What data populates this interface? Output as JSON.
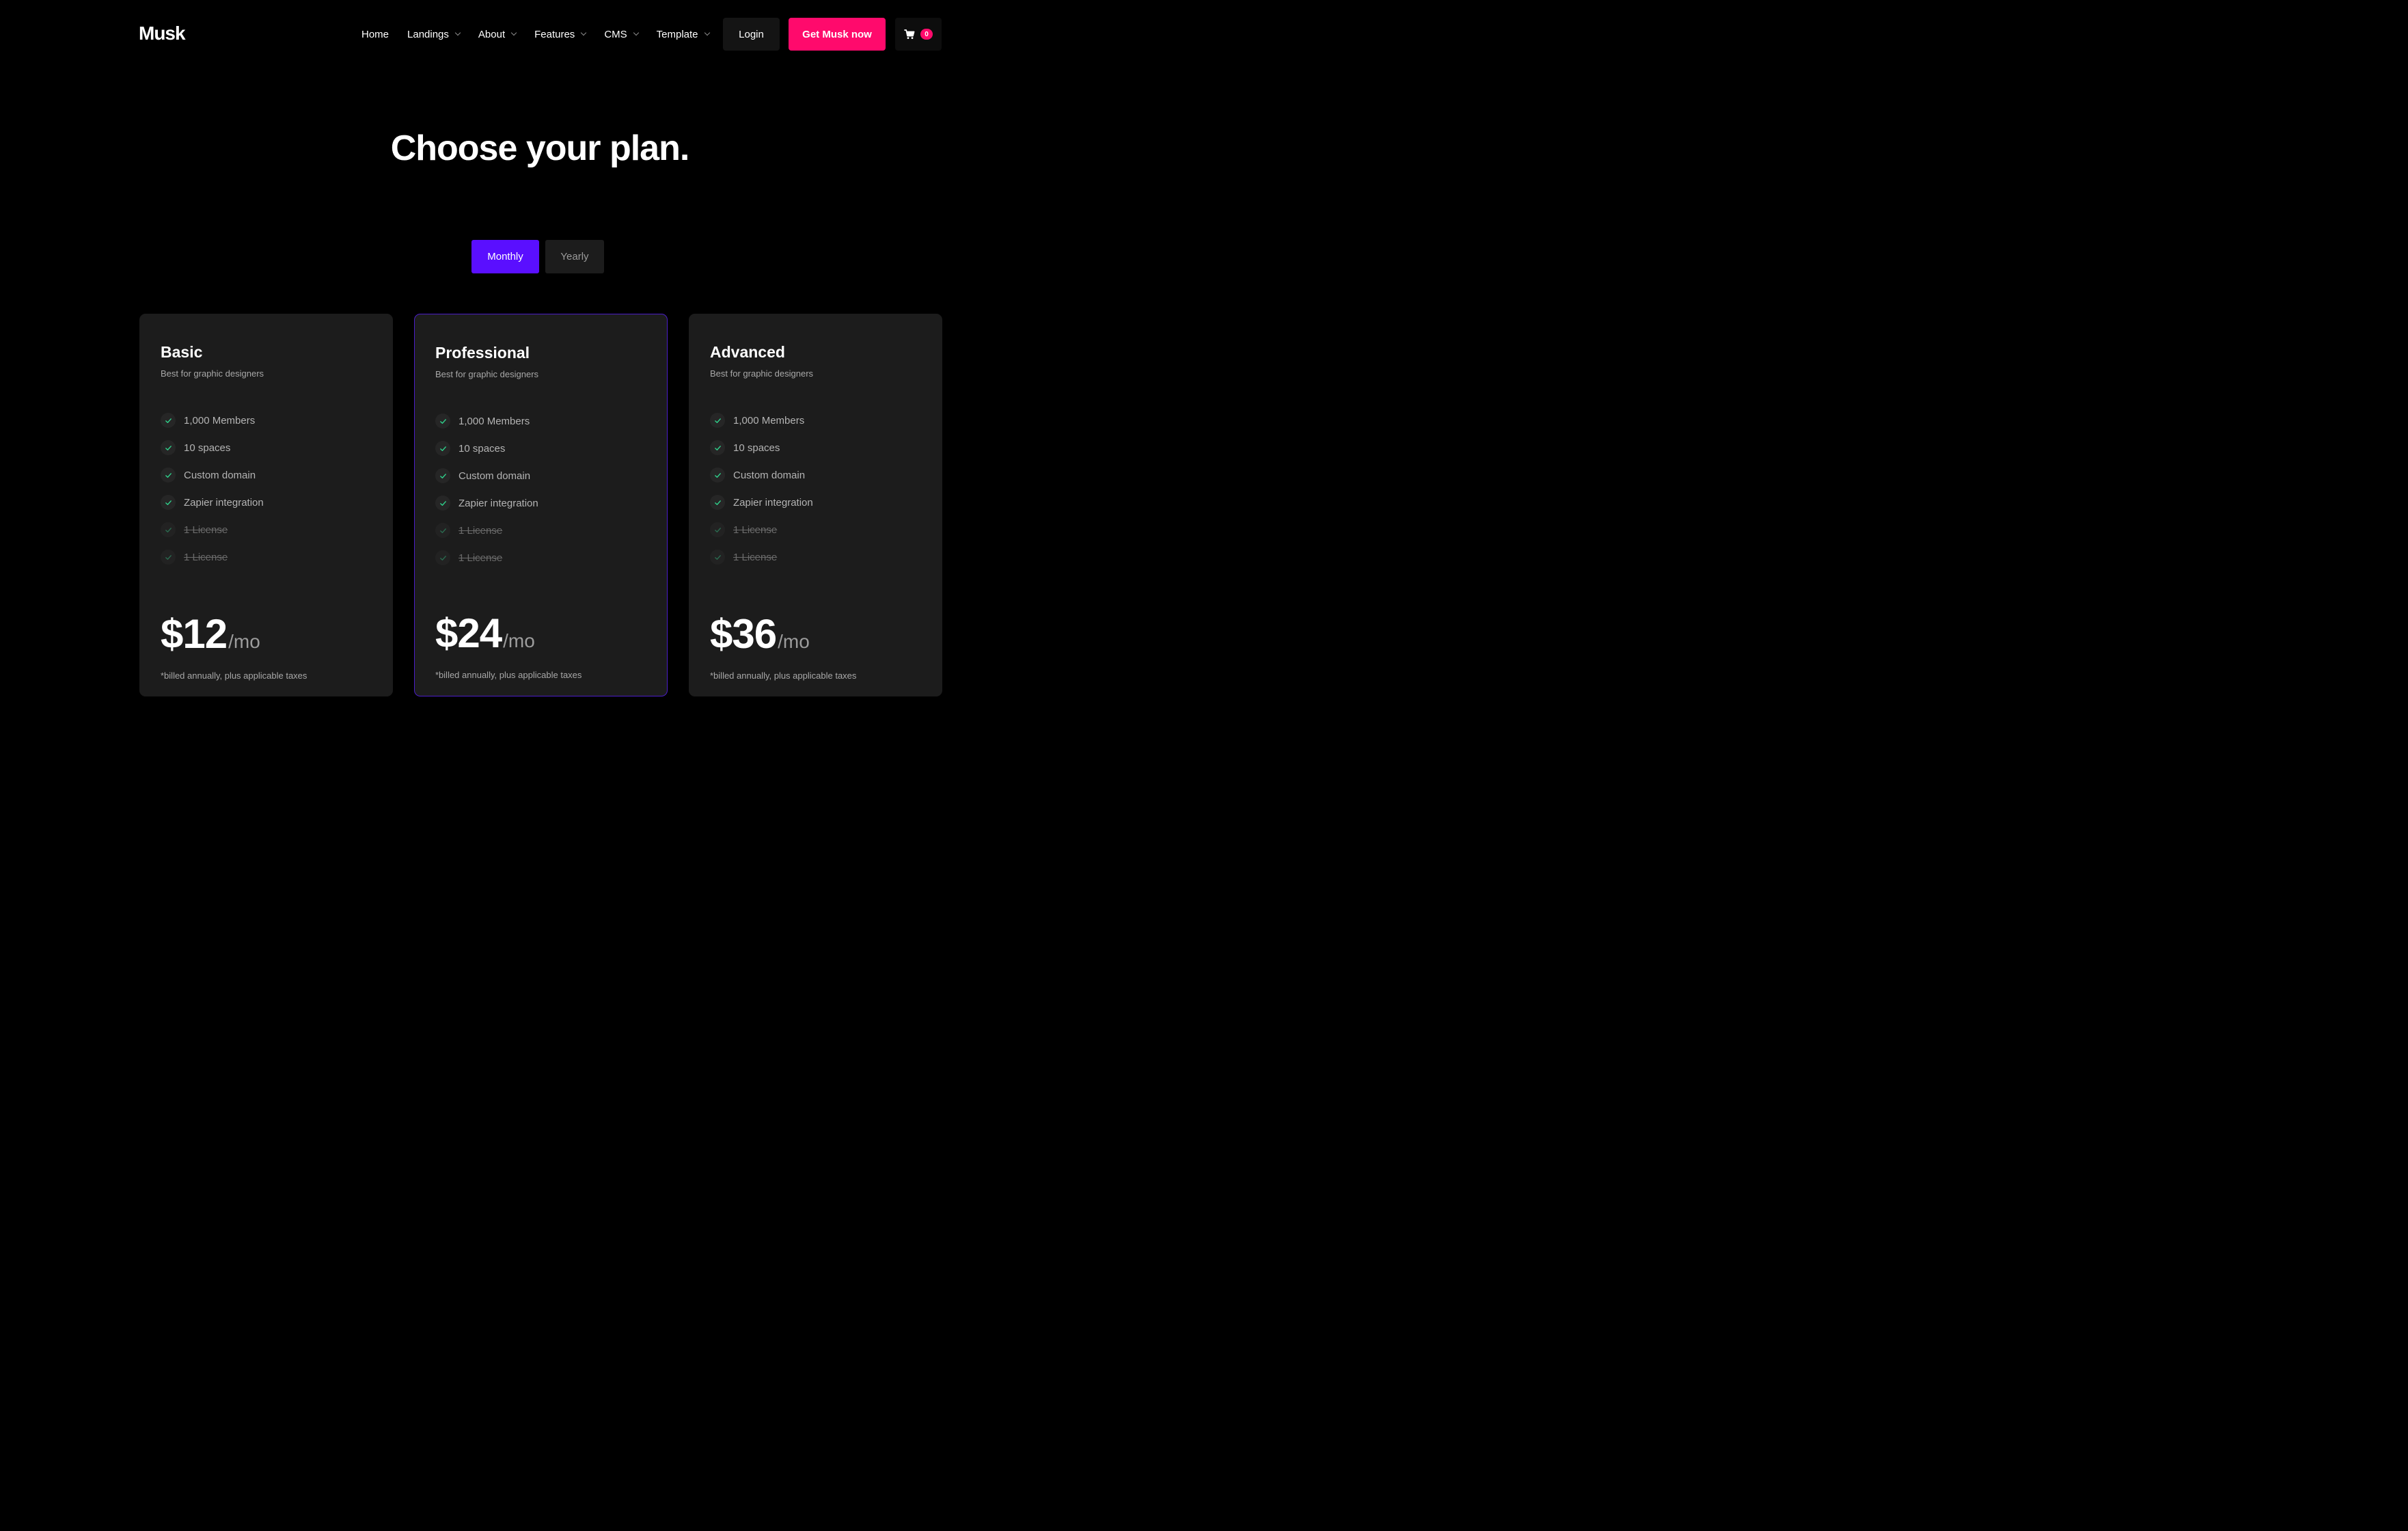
{
  "brand": {
    "logo_text": "Musk",
    "accent_pink": "#ff0a6c",
    "accent_purple": "#5a0fff"
  },
  "nav": {
    "items": [
      {
        "label": "Home",
        "has_dropdown": false
      },
      {
        "label": "Landings",
        "has_dropdown": true
      },
      {
        "label": "About",
        "has_dropdown": true
      },
      {
        "label": "Features",
        "has_dropdown": true
      },
      {
        "label": "CMS",
        "has_dropdown": true
      },
      {
        "label": "Template",
        "has_dropdown": true
      }
    ],
    "login_label": "Login",
    "cta_label": "Get Musk now",
    "cart": {
      "icon": "cart-icon",
      "count": "0"
    }
  },
  "hero": {
    "title": "Choose your plan."
  },
  "billing_toggle": {
    "monthly_label": "Monthly",
    "yearly_label": "Yearly",
    "selected": "Monthly"
  },
  "plans": [
    {
      "name": "Basic",
      "subtitle": "Best for graphic designers",
      "featured": false,
      "features": [
        {
          "label": "1,000 Members",
          "included": true
        },
        {
          "label": "10 spaces",
          "included": true
        },
        {
          "label": "Custom domain",
          "included": true
        },
        {
          "label": "Zapier integration",
          "included": true
        },
        {
          "label": "1 License",
          "included": false
        },
        {
          "label": "1 License",
          "included": false
        }
      ],
      "price": "$12",
      "period": "/mo",
      "note": "*billed annually, plus applicable taxes"
    },
    {
      "name": "Professional",
      "subtitle": "Best for graphic designers",
      "featured": true,
      "features": [
        {
          "label": "1,000 Members",
          "included": true
        },
        {
          "label": "10 spaces",
          "included": true
        },
        {
          "label": "Custom domain",
          "included": true
        },
        {
          "label": "Zapier integration",
          "included": true
        },
        {
          "label": "1 License",
          "included": false
        },
        {
          "label": "1 License",
          "included": false
        }
      ],
      "price": "$24",
      "period": "/mo",
      "note": "*billed annually, plus applicable taxes"
    },
    {
      "name": "Advanced",
      "subtitle": "Best for graphic designers",
      "featured": false,
      "features": [
        {
          "label": "1,000 Members",
          "included": true
        },
        {
          "label": "10 spaces",
          "included": true
        },
        {
          "label": "Custom domain",
          "included": true
        },
        {
          "label": "Zapier integration",
          "included": true
        },
        {
          "label": "1 License",
          "included": false
        },
        {
          "label": "1 License",
          "included": false
        }
      ],
      "price": "$36",
      "period": "/mo",
      "note": "*billed annually, plus applicable taxes"
    }
  ]
}
